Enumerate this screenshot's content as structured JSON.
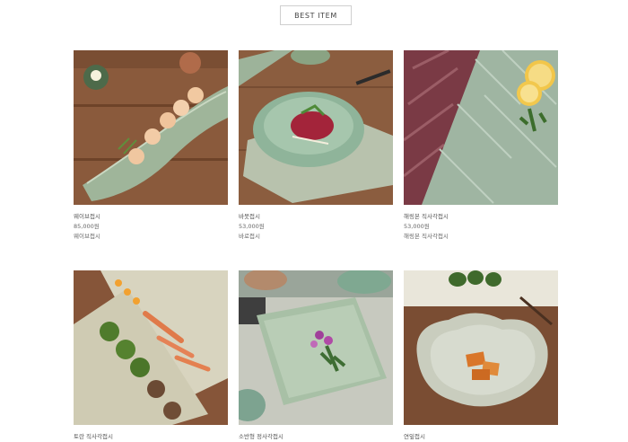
{
  "section": {
    "title": "BEST ITEM"
  },
  "products": [
    {
      "name": "웨이브접시",
      "price": "85,000원",
      "subtitle": "웨이브접시"
    },
    {
      "name": "바못접시",
      "price": "53,000원",
      "subtitle": "바로접시"
    },
    {
      "name": "해링본 직사각접시",
      "price": "53,000원",
      "subtitle": "해링본 직사각접시"
    },
    {
      "name": "토란 직사각접시"
    },
    {
      "name": "소반형 정사각접시"
    },
    {
      "name": "연잎접시"
    }
  ]
}
